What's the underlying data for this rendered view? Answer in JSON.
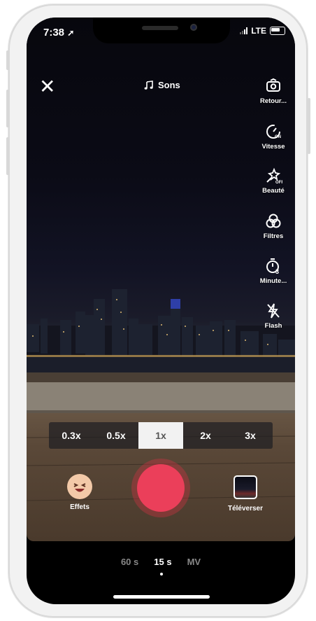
{
  "status_bar": {
    "time": "7:38",
    "network": "LTE"
  },
  "top": {
    "close_symbol": "✕",
    "sound_label": "Sons"
  },
  "right_toolbar": [
    {
      "icon": "flip-camera-icon",
      "label": "Retour..."
    },
    {
      "icon": "speed-icon",
      "label": "Vitesse"
    },
    {
      "icon": "beauty-icon",
      "label": "Beauté"
    },
    {
      "icon": "filters-icon",
      "label": "Filtres"
    },
    {
      "icon": "timer-icon",
      "label": "Minute..."
    },
    {
      "icon": "flash-off-icon",
      "label": "Flash"
    }
  ],
  "zoom": {
    "options": [
      "0.3x",
      "0.5x",
      "1x",
      "2x",
      "3x"
    ],
    "selected": "1x"
  },
  "bottom_controls": {
    "effects_label": "Effets",
    "upload_label": "Téléverser"
  },
  "durations": {
    "options": [
      "60 s",
      "15 s",
      "MV"
    ],
    "selected": "15 s"
  },
  "colors": {
    "record": "#eb3f5a",
    "zoom_active_bg": "#f2f2f2"
  }
}
